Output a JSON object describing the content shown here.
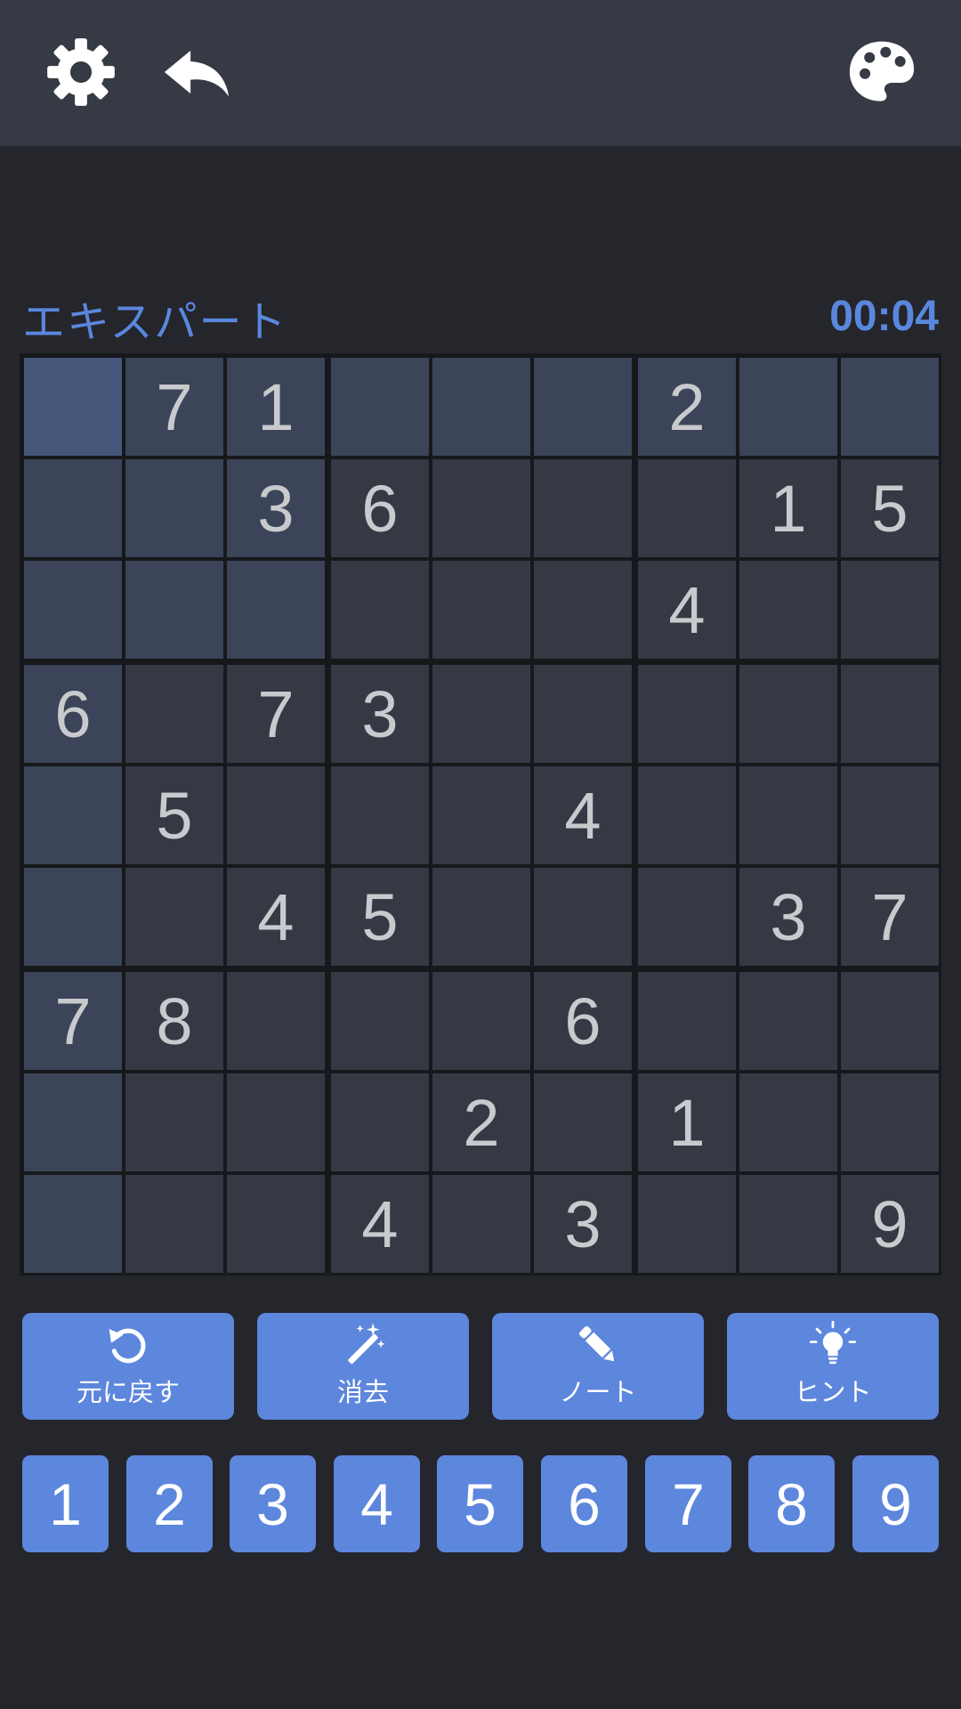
{
  "header": {
    "settings_icon": "gear-icon",
    "undo_icon": "undo-arrow-icon",
    "theme_icon": "palette-icon"
  },
  "game": {
    "level": "エキスパート",
    "timer": "00:04"
  },
  "board": {
    "selected": [
      0,
      0
    ],
    "cells": [
      [
        "",
        "7",
        "1",
        "",
        "",
        "",
        "2",
        "",
        ""
      ],
      [
        "",
        "",
        "3",
        "6",
        "",
        "",
        "",
        "1",
        "5"
      ],
      [
        "",
        "",
        "",
        "",
        "",
        "",
        "4",
        "",
        ""
      ],
      [
        "6",
        "",
        "7",
        "3",
        "",
        "",
        "",
        "",
        ""
      ],
      [
        "",
        "5",
        "",
        "",
        "",
        "4",
        "",
        "",
        ""
      ],
      [
        "",
        "",
        "4",
        "5",
        "",
        "",
        "",
        "3",
        "7"
      ],
      [
        "7",
        "8",
        "",
        "",
        "",
        "6",
        "",
        "",
        ""
      ],
      [
        "",
        "",
        "",
        "",
        "2",
        "",
        "1",
        "",
        ""
      ],
      [
        "",
        "",
        "",
        "4",
        "",
        "3",
        "",
        "",
        "9"
      ]
    ]
  },
  "tools": [
    {
      "label": "元に戻す",
      "icon": "rotate-ccw-icon"
    },
    {
      "label": "消去",
      "icon": "magic-wand-icon"
    },
    {
      "label": "ノート",
      "icon": "pencil-icon"
    },
    {
      "label": "ヒント",
      "icon": "lightbulb-icon"
    }
  ],
  "numpad": [
    "1",
    "2",
    "3",
    "4",
    "5",
    "6",
    "7",
    "8",
    "9"
  ],
  "colors": {
    "accent": "#5d86dd",
    "background": "#25262b",
    "topbar": "#353a44",
    "cell": "#353943",
    "cell_highlight": "#3b4458",
    "cell_selected": "#45567a",
    "digit": "#c9cacd"
  }
}
